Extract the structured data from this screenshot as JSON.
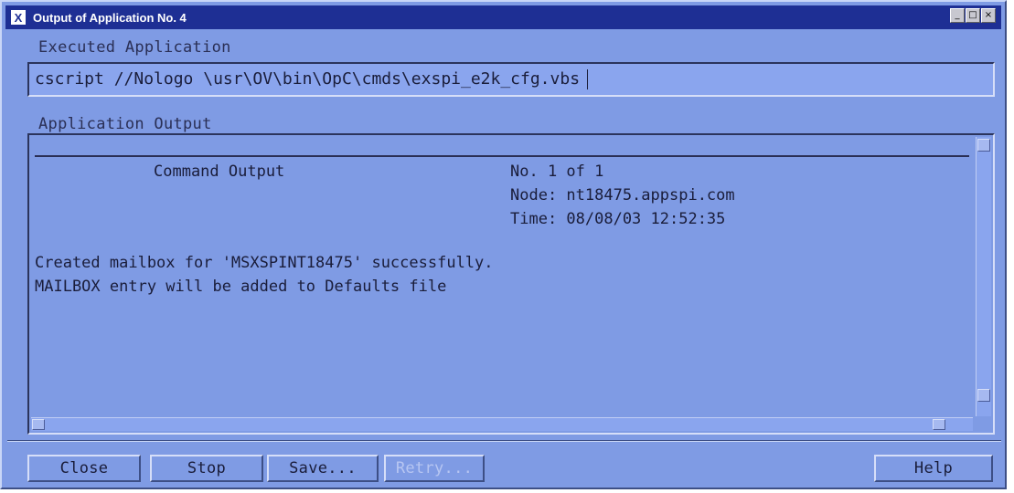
{
  "window": {
    "title": "Output of Application No. 4",
    "controls": [
      "minimize",
      "maximize",
      "close"
    ]
  },
  "executed_application": {
    "label": "Executed Application",
    "value": "cscript //Nologo \\usr\\OV\\bin\\OpC\\cmds\\exspi_e2k_cfg.vbs"
  },
  "application_output": {
    "label": "Application Output",
    "header": {
      "title": "Command Output",
      "counter": "No. 1 of 1",
      "node": "Node: nt18475.appspi.com",
      "time": "Time: 08/08/03 12:52:35"
    },
    "lines": [
      "Created mailbox for 'MSXSPINT18475' successfully.",
      "MAILBOX entry will be added to Defaults file"
    ]
  },
  "buttons": {
    "close": "Close",
    "stop": "Stop",
    "save": "Save...",
    "retry": "Retry...",
    "help": "Help"
  },
  "colors": {
    "background": "#7f9be4",
    "titlebar": "#1e2f94"
  }
}
